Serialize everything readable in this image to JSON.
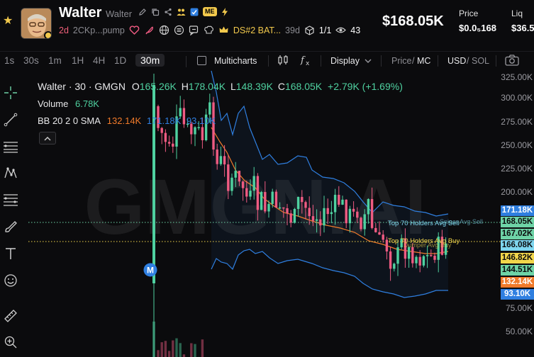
{
  "token": {
    "name": "Walter",
    "handle": "Walter",
    "badge": "ME",
    "age": "2d",
    "address": "2CKp...pump",
    "rank": "DS#2 BAT...",
    "rank_age": "39d",
    "holders": "1/1",
    "views": "43"
  },
  "market": {
    "price_big": "$168.05K",
    "price_label": "Price",
    "price_value": "$0.0₅168",
    "liq_label": "Liq",
    "liq_value": "$36.5"
  },
  "toolbar": {
    "timeframes": [
      "1s",
      "30s",
      "1m",
      "1H",
      "4H",
      "1D",
      "30m"
    ],
    "active_timeframe": "30m",
    "multicharts": "Multicharts",
    "display": "Display",
    "price_label": "Price",
    "mc_label": "MC",
    "usd_label": "USD",
    "sol_label": "SOL"
  },
  "chart": {
    "symbol_line": "Walter · 30 · GMGN",
    "o_label": "O",
    "o_value": "165.26K",
    "h_label": "H",
    "h_value": "178.04K",
    "l_label": "L",
    "l_value": "148.39K",
    "c_label": "C",
    "c_value": "168.05K",
    "change": "+2.79K (+1.69%)",
    "volume_label": "Volume",
    "volume_value": "6.78K",
    "bb_label": "BB 20 2 0 SMA",
    "bb_mid": "132.14K",
    "bb_upper": "171.18K",
    "bb_lower": "93.10K",
    "watermark": "GMGN.AI",
    "marker_label": "M",
    "overlay_sell": "Top 70 Holders Avg Sell",
    "overlay_sell_2": "Sniper Avg Sell",
    "overlay_buy": "Top 70 Holders Avg Buy",
    "overlay_buy_2": "Dumper Avg Buy"
  },
  "axis_labels": [
    "325.00K",
    "300.00K",
    "275.00K",
    "250.00K",
    "225.00K",
    "200.00K",
    "75.00K",
    "50.00K"
  ],
  "price_tags": [
    {
      "value": "171.18K",
      "bg": "#2f7fe0",
      "color": "#ffffff"
    },
    {
      "value": "168.05K",
      "bg": "#6ed3a6",
      "color": "#0b0b0d"
    },
    {
      "value": "167.02K",
      "bg": "#6ed3a6",
      "color": "#0b0b0d"
    },
    {
      "value": "166.08K",
      "bg": "#7fd7f0",
      "color": "#0b0b0d"
    },
    {
      "value": "146.82K",
      "bg": "#f2d64b",
      "color": "#0b0b0d"
    },
    {
      "value": "144.51K",
      "bg": "#6ed3a6",
      "color": "#0b0b0d"
    },
    {
      "value": "132.14K",
      "bg": "#f07a2a",
      "color": "#ffffff"
    },
    {
      "value": "93.10K",
      "bg": "#2f7fe0",
      "color": "#ffffff"
    }
  ],
  "colors": {
    "up": "#4fd1a0",
    "down": "#ef5b82",
    "bb_upper": "#2f7fe0",
    "bb_mid": "#f07a2a",
    "accent": "#f2c94c"
  }
}
